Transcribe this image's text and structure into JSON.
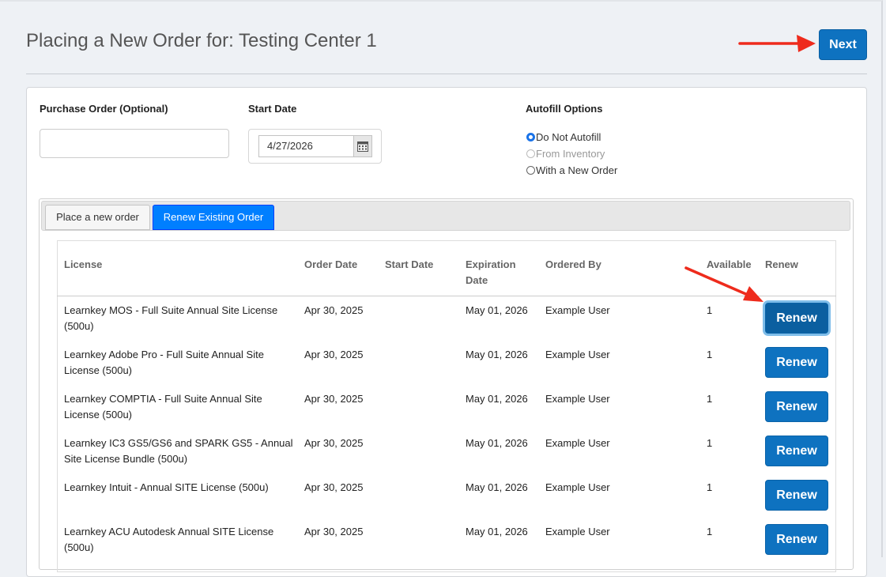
{
  "header": {
    "title": "Placing a New Order for: Testing Center 1",
    "next_label": "Next"
  },
  "form": {
    "purchase_order_label": "Purchase Order (Optional)",
    "purchase_order_value": "",
    "start_date_label": "Start Date",
    "start_date_value": "4/27/2026",
    "autofill_label": "Autofill Options",
    "autofill_options": [
      {
        "label": "Do Not Autofill",
        "checked": true,
        "disabled": false
      },
      {
        "label": "From Inventory",
        "checked": false,
        "disabled": true
      },
      {
        "label": "With a New Order",
        "checked": false,
        "disabled": false
      }
    ]
  },
  "tabs": [
    {
      "label": "Place a new order",
      "active": false
    },
    {
      "label": "Renew Existing Order",
      "active": true
    }
  ],
  "table": {
    "columns": {
      "license": "License",
      "order_date": "Order Date",
      "start_date": "Start Date",
      "expiration_date": "Expiration Date",
      "ordered_by": "Ordered By",
      "available": "Available",
      "renew": "Renew"
    },
    "rows": [
      {
        "license": "Learnkey MOS - Full Suite Annual Site License (500u)",
        "order_date": "Apr 30, 2025",
        "start_date": "",
        "expiration_date": "May 01, 2026",
        "ordered_by": "Example User",
        "available": "1",
        "renew_label": "Renew"
      },
      {
        "license": "Learnkey Adobe Pro - Full Suite Annual Site License (500u)",
        "order_date": "Apr 30, 2025",
        "start_date": "",
        "expiration_date": "May 01, 2026",
        "ordered_by": "Example User",
        "available": "1",
        "renew_label": "Renew"
      },
      {
        "license": "Learnkey COMPTIA - Full Suite Annual Site License (500u)",
        "order_date": "Apr 30, 2025",
        "start_date": "",
        "expiration_date": "May 01, 2026",
        "ordered_by": "Example User",
        "available": "1",
        "renew_label": "Renew"
      },
      {
        "license": "Learnkey IC3 GS5/GS6 and SPARK GS5 - Annual Site License Bundle (500u)",
        "order_date": "Apr 30, 2025",
        "start_date": "",
        "expiration_date": "May 01, 2026",
        "ordered_by": "Example User",
        "available": "1",
        "renew_label": "Renew"
      },
      {
        "license": "Learnkey Intuit - Annual SITE License (500u)",
        "order_date": "Apr 30, 2025",
        "start_date": "",
        "expiration_date": "May 01, 2026",
        "ordered_by": "Example User",
        "available": "1",
        "renew_label": "Renew"
      },
      {
        "license": "Learnkey ACU Autodesk Annual SITE License (500u)",
        "order_date": "Apr 30, 2025",
        "start_date": "",
        "expiration_date": "May 01, 2026",
        "ordered_by": "Example User",
        "available": "1",
        "renew_label": "Renew"
      }
    ]
  },
  "colors": {
    "primary_button": "#0e72c0",
    "active_tab": "#007fff",
    "annotation_arrow": "#ee2b1c"
  },
  "icons": {
    "calendar": "calendar-icon",
    "annotation_arrow": "red-arrow-icon"
  }
}
